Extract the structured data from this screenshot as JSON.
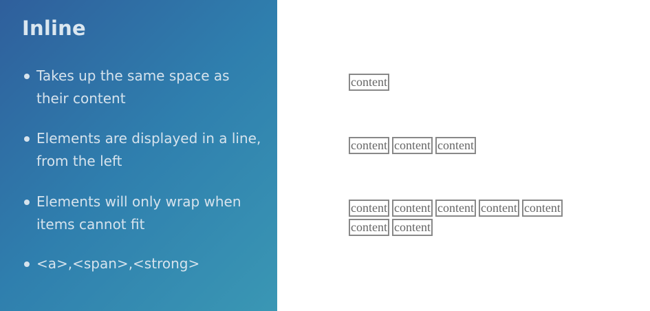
{
  "left": {
    "title": "Inline",
    "bullets": [
      {
        "text": "Takes up the same space as their content"
      },
      {
        "text": "Elements are displayed in a line, from the left"
      },
      {
        "text": "Elements will only wrap when items cannot fit"
      },
      {
        "text": "<a>,<span>,<strong>"
      }
    ]
  },
  "right": {
    "rows": [
      {
        "items": [
          "content"
        ]
      },
      {
        "items": [
          "content",
          "content",
          "content"
        ]
      },
      {
        "items": [
          "content",
          "content",
          "content",
          "content",
          "content",
          "content",
          "content"
        ]
      }
    ]
  },
  "colors": {
    "panel_start": "#2f5f9c",
    "panel_end": "#3a97b4",
    "box_border": "#888888",
    "box_text": "#666666"
  }
}
